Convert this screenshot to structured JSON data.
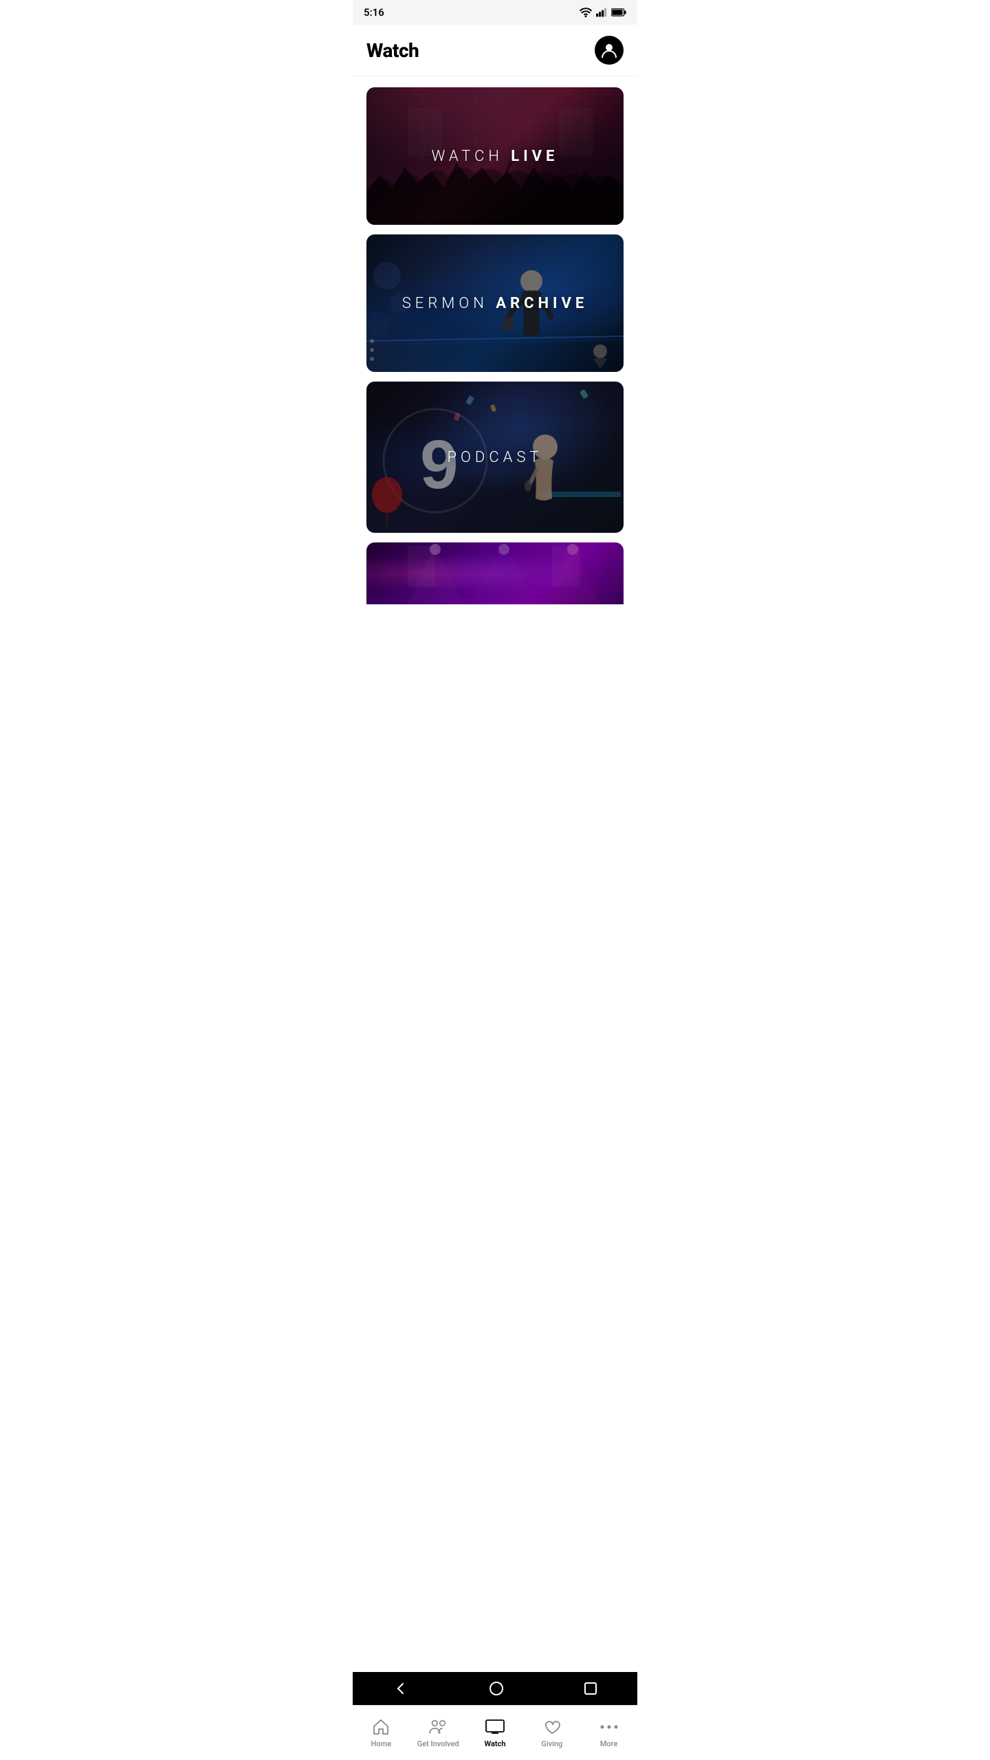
{
  "statusBar": {
    "time": "5:16",
    "wifiIcon": "wifi",
    "signalIcon": "signal",
    "batteryIcon": "battery"
  },
  "header": {
    "title": "Watch",
    "avatarIcon": "user-avatar"
  },
  "cards": [
    {
      "id": "watch-live",
      "label": "WATCH ",
      "labelBold": "LIVE",
      "type": "watch-live"
    },
    {
      "id": "sermon-archive",
      "label": "SERMON ",
      "labelBold": "ARCHIVE",
      "type": "sermon"
    },
    {
      "id": "podcast",
      "label": "PODCAST",
      "labelBold": "",
      "type": "podcast"
    },
    {
      "id": "fourth-card",
      "label": "",
      "labelBold": "",
      "type": "partial"
    }
  ],
  "bottomNav": {
    "items": [
      {
        "id": "home",
        "label": "Home",
        "icon": "home-icon",
        "active": false
      },
      {
        "id": "get-involved",
        "label": "Get Involved",
        "icon": "get-involved-icon",
        "active": false
      },
      {
        "id": "watch",
        "label": "Watch",
        "icon": "watch-icon",
        "active": true
      },
      {
        "id": "giving",
        "label": "Giving",
        "icon": "giving-icon",
        "active": false
      },
      {
        "id": "more",
        "label": "More",
        "icon": "more-icon",
        "active": false
      }
    ]
  },
  "androidNav": {
    "backIcon": "back-arrow",
    "homeIcon": "home-circle",
    "recentIcon": "recent-square"
  }
}
